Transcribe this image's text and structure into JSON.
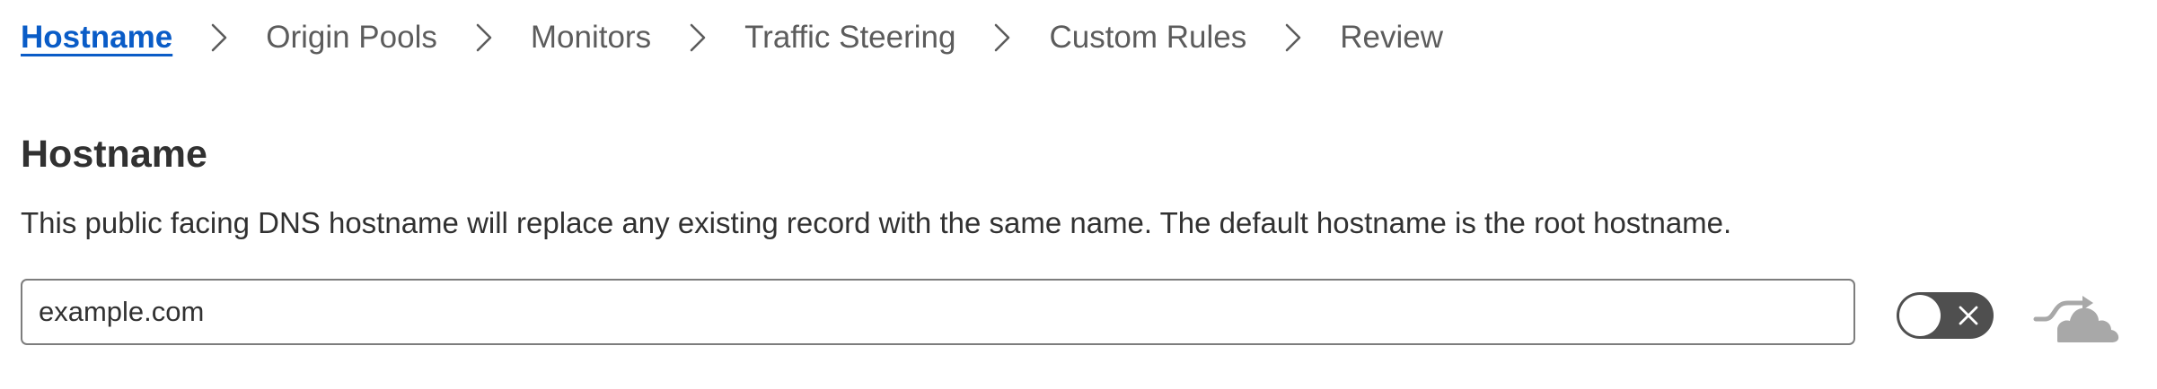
{
  "steps": [
    {
      "label": "Hostname",
      "active": true
    },
    {
      "label": "Origin Pools",
      "active": false
    },
    {
      "label": "Monitors",
      "active": false
    },
    {
      "label": "Traffic Steering",
      "active": false
    },
    {
      "label": "Custom Rules",
      "active": false
    },
    {
      "label": "Review",
      "active": false
    }
  ],
  "section": {
    "title": "Hostname",
    "description": "This public facing DNS hostname will replace any existing record with the same name. The default hostname is the root hostname."
  },
  "hostname_input": {
    "value": "example.com",
    "placeholder": ""
  },
  "proxy_toggle": {
    "state": "off"
  },
  "icons": {
    "step_separator": "chevron-right-icon",
    "toggle_off": "close-icon",
    "proxy_status": "cloud-proxy-icon"
  },
  "colors": {
    "active_step": "#0a5cc7",
    "inactive_step": "#5c5c5c",
    "toggle_bg": "#4f4f4f",
    "cloud_gray": "#a8a8a8"
  }
}
